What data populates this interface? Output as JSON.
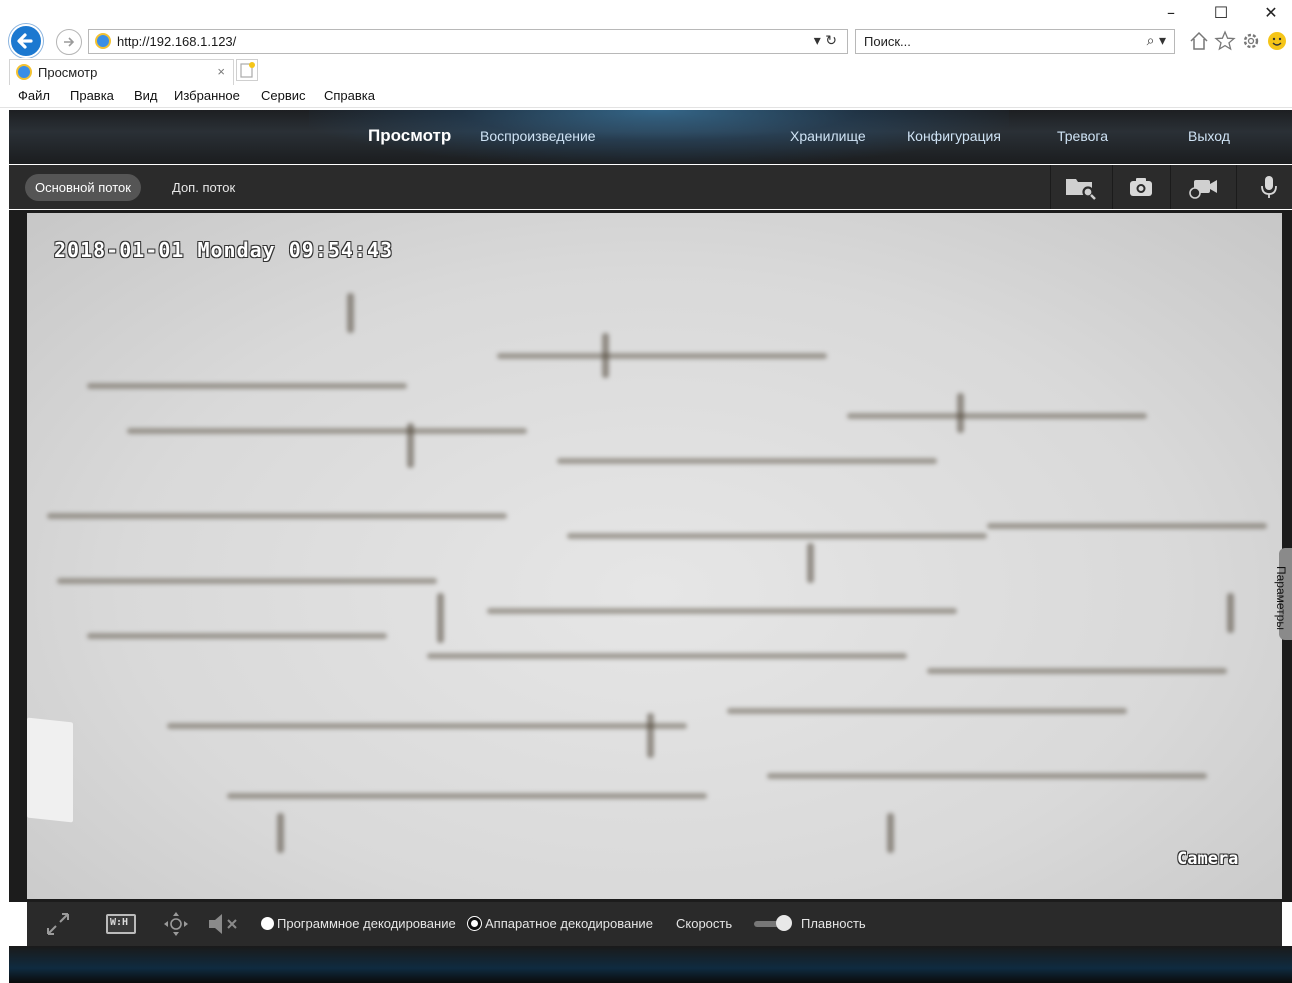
{
  "browser": {
    "url": "http://192.168.1.123/",
    "search_placeholder": "Поиск...",
    "tab_title": "Просмотр",
    "tab_close": "×",
    "window_controls": {
      "minimize": "–",
      "maximize": "☐",
      "close": "✕"
    },
    "refresh_glyph": "▾ ↻",
    "search_glyph": "⌕ ▾",
    "toolbar_icons": [
      "home-icon",
      "star-icon",
      "gear-icon",
      "smiley-icon"
    ],
    "menu": [
      "Файл",
      "Правка",
      "Вид",
      "Избранное",
      "Сервис",
      "Справка"
    ]
  },
  "app": {
    "nav": {
      "view": "Просмотр",
      "playback": "Воспроизведение",
      "storage": "Хранилище",
      "config": "Конфигурация",
      "alarm": "Тревога",
      "logout": "Выход"
    },
    "streams": {
      "main": "Основной поток",
      "sub": "Доп. поток"
    },
    "toolbar_icons": [
      "folder-search-icon",
      "camera-snapshot-icon",
      "record-icon",
      "microphone-icon"
    ],
    "osd": {
      "datetime": "2018-01-01 Monday 09:54:43",
      "camera_name": "Camera"
    },
    "side_tab": "Параметры",
    "bottom": {
      "software_decoding": "Программное декодирование",
      "hardware_decoding": "Аппаратное декодирование",
      "selected_decoding": "hardware",
      "speed_label": "Скорость",
      "smooth_label": "Плавность",
      "ratio_button": "W:H",
      "speed_slider_value": 0.7
    },
    "colors": {
      "accent": "#47a0dc",
      "bar": "#2a2a2a",
      "nav_bg": "#1d1f22"
    }
  }
}
